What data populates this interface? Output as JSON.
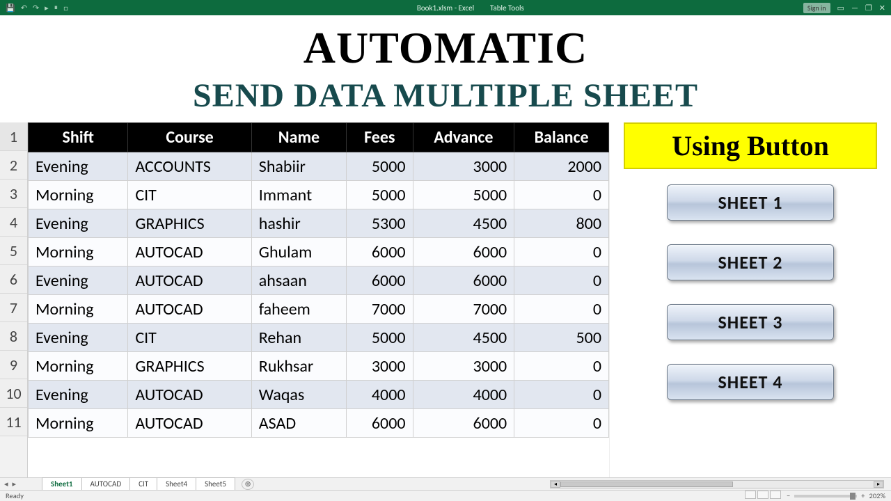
{
  "titlebar": {
    "doc": "Book1.xlsm - Excel",
    "context": "Table Tools",
    "signin": "Sign in"
  },
  "overlay": {
    "line1": "AUTOMATIC",
    "line2": "SEND DATA MULTIPLE SHEET"
  },
  "row_numbers": [
    "1",
    "2",
    "3",
    "4",
    "5",
    "6",
    "7",
    "8",
    "9",
    "10",
    "11"
  ],
  "columns": [
    "Shift",
    "Course",
    "Name",
    "Fees",
    "Advance",
    "Balance"
  ],
  "rows": [
    {
      "shift": "Evening",
      "course": "ACCOUNTS",
      "name": "Shabiir",
      "fees": "5000",
      "advance": "3000",
      "balance": "2000"
    },
    {
      "shift": "Morning",
      "course": "CIT",
      "name": "Immant",
      "fees": "5000",
      "advance": "5000",
      "balance": "0"
    },
    {
      "shift": "Evening",
      "course": "GRAPHICS",
      "name": "hashir",
      "fees": "5300",
      "advance": "4500",
      "balance": "800"
    },
    {
      "shift": "Morning",
      "course": "AUTOCAD",
      "name": "Ghulam",
      "fees": "6000",
      "advance": "6000",
      "balance": "0"
    },
    {
      "shift": "Evening",
      "course": "AUTOCAD",
      "name": "ahsaan",
      "fees": "6000",
      "advance": "6000",
      "balance": "0"
    },
    {
      "shift": "Morning",
      "course": "AUTOCAD",
      "name": "faheem",
      "fees": "7000",
      "advance": "7000",
      "balance": "0"
    },
    {
      "shift": "Evening",
      "course": "CIT",
      "name": "Rehan",
      "fees": "5000",
      "advance": "4500",
      "balance": "500"
    },
    {
      "shift": "Morning",
      "course": "GRAPHICS",
      "name": "Rukhsar",
      "fees": "3000",
      "advance": "3000",
      "balance": "0"
    },
    {
      "shift": "Evening",
      "course": "AUTOCAD",
      "name": "Waqas",
      "fees": "4000",
      "advance": "4000",
      "balance": "0"
    },
    {
      "shift": "Morning",
      "course": "AUTOCAD",
      "name": "ASAD",
      "fees": "6000",
      "advance": "6000",
      "balance": "0"
    }
  ],
  "rightpanel": {
    "label": "Using Button",
    "buttons": [
      "SHEET 1",
      "SHEET 2",
      "SHEET 3",
      "SHEET 4"
    ]
  },
  "sheet_tabs": [
    "Sheet1",
    "AUTOCAD",
    "CIT",
    "Sheet4",
    "Sheet5"
  ],
  "active_tab_index": 0,
  "status": {
    "ready": "Ready",
    "zoom": "202%"
  }
}
